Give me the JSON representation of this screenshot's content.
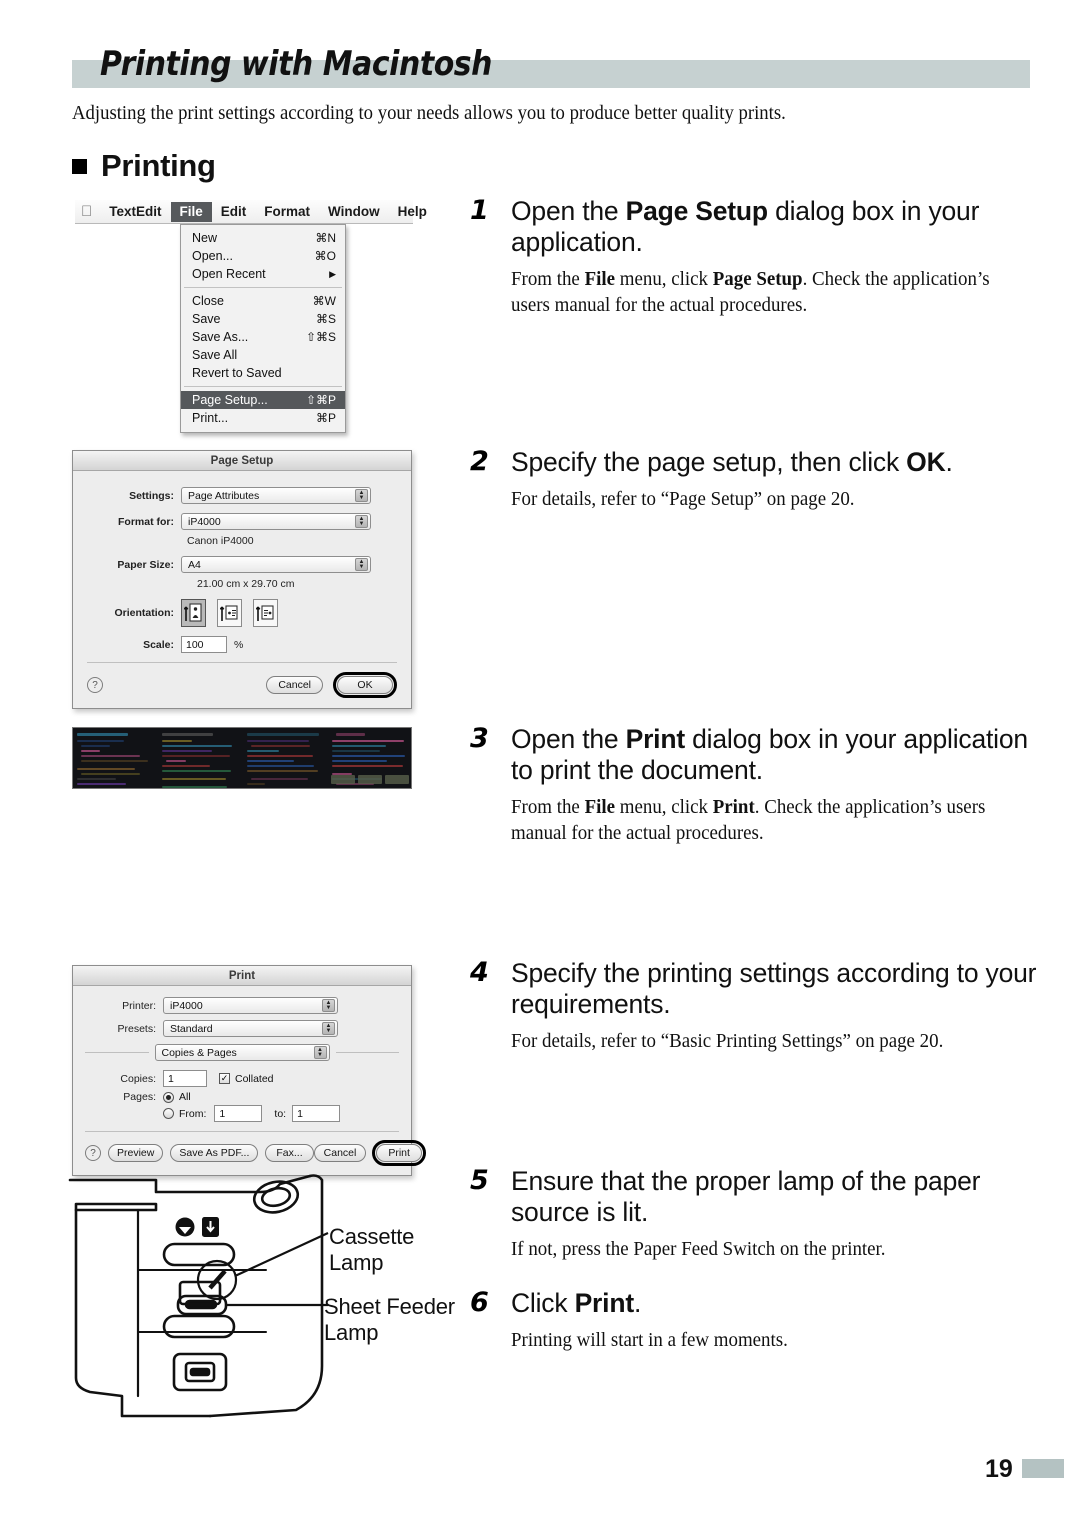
{
  "page": {
    "title": "Printing with Macintosh",
    "intro": "Adjusting the print settings according to your needs allows you to produce better quality prints.",
    "section_heading": "Printing",
    "page_number": "19",
    "header_bar_color": "#c6d1d1",
    "footer_block_color": "#b4c2c2"
  },
  "steps": [
    {
      "num": "1",
      "title_parts": [
        {
          "text": "Open the ",
          "bold": false
        },
        {
          "text": "Page Setup",
          "bold": true
        },
        {
          "text": " dialog box in your application.",
          "bold": false
        }
      ],
      "body_parts": [
        {
          "text": "From the ",
          "bold": false
        },
        {
          "text": "File",
          "bold": true
        },
        {
          "text": " menu, click ",
          "bold": false
        },
        {
          "text": "Page Setup",
          "bold": true
        },
        {
          "text": ". Check the application’s users manual for the actual procedures.",
          "bold": false
        }
      ]
    },
    {
      "num": "2",
      "title_parts": [
        {
          "text": "Specify the page setup, then click ",
          "bold": false
        },
        {
          "text": "OK",
          "bold": true
        },
        {
          "text": ".",
          "bold": false
        }
      ],
      "body_parts": [
        {
          "text": "For details, refer to “Page Setup” on page 20.",
          "bold": false
        }
      ]
    },
    {
      "num": "3",
      "title_parts": [
        {
          "text": "Open the ",
          "bold": false
        },
        {
          "text": "Print",
          "bold": true
        },
        {
          "text": " dialog box in your application to print the document.",
          "bold": false
        }
      ],
      "body_parts": [
        {
          "text": "From the ",
          "bold": false
        },
        {
          "text": "File",
          "bold": true
        },
        {
          "text": " menu, click ",
          "bold": false
        },
        {
          "text": "Print",
          "bold": true
        },
        {
          "text": ". Check the application’s users manual for the actual procedures.",
          "bold": false
        }
      ]
    },
    {
      "num": "4",
      "title_parts": [
        {
          "text": "Specify the printing settings according to your requirements.",
          "bold": false
        }
      ],
      "body_parts": [
        {
          "text": "For details, refer to “Basic Printing Settings” on page 20.",
          "bold": false
        }
      ]
    },
    {
      "num": "5",
      "title_parts": [
        {
          "text": "Ensure that the proper lamp of the paper source is lit.",
          "bold": false
        }
      ],
      "body_parts": [
        {
          "text": "If not, press the Paper Feed Switch on the printer.",
          "bold": false
        }
      ]
    },
    {
      "num": "6",
      "title_parts": [
        {
          "text": "Click ",
          "bold": false
        },
        {
          "text": "Print",
          "bold": true
        },
        {
          "text": ".",
          "bold": false
        }
      ],
      "body_parts": [
        {
          "text": "Printing will start in a few moments.",
          "bold": false
        }
      ]
    }
  ],
  "menu_screenshot": {
    "menubar": {
      "apple_icon": "apple-icon",
      "items": [
        {
          "label": "TextEdit",
          "selected": false
        },
        {
          "label": "File",
          "selected": true
        },
        {
          "label": "Edit",
          "selected": false
        },
        {
          "label": "Format",
          "selected": false
        },
        {
          "label": "Window",
          "selected": false
        },
        {
          "label": "Help",
          "selected": false
        }
      ]
    },
    "file_menu": [
      {
        "label": "New",
        "key": "⌘N",
        "highlight": false,
        "separator_after": false
      },
      {
        "label": "Open...",
        "key": "⌘O",
        "highlight": false,
        "separator_after": false
      },
      {
        "label": "Open Recent",
        "key": "▶",
        "highlight": false,
        "separator_after": true
      },
      {
        "label": "Close",
        "key": "⌘W",
        "highlight": false,
        "separator_after": false
      },
      {
        "label": "Save",
        "key": "⌘S",
        "highlight": false,
        "separator_after": false
      },
      {
        "label": "Save As...",
        "key": "⇧⌘S",
        "highlight": false,
        "separator_after": false
      },
      {
        "label": "Save All",
        "key": "",
        "highlight": false,
        "separator_after": false
      },
      {
        "label": "Revert to Saved",
        "key": "",
        "highlight": false,
        "separator_after": true
      },
      {
        "label": "Page Setup...",
        "key": "⇧⌘P",
        "highlight": true,
        "separator_after": false
      },
      {
        "label": "Print...",
        "key": "⌘P",
        "highlight": false,
        "separator_after": false
      }
    ]
  },
  "page_setup_dialog": {
    "title": "Page Setup",
    "settings_label": "Settings:",
    "settings_value": "Page Attributes",
    "format_for_label": "Format for:",
    "format_for_value": "iP4000",
    "printer_note": "Canon iP4000",
    "paper_size_label": "Paper Size:",
    "paper_size_value": "A4",
    "paper_dimensions": "21.00 cm x 29.70 cm",
    "orientation_label": "Orientation:",
    "orientation_options": [
      "portrait",
      "landscape",
      "landscape-reverse"
    ],
    "orientation_selected_index": 0,
    "scale_label": "Scale:",
    "scale_value": "100",
    "scale_unit": "%",
    "help_label": "?",
    "cancel_label": "Cancel",
    "ok_label": "OK"
  },
  "print_dialog": {
    "title": "Print",
    "printer_label": "Printer:",
    "printer_value": "iP4000",
    "presets_label": "Presets:",
    "presets_value": "Standard",
    "pane_value": "Copies & Pages",
    "copies_label": "Copies:",
    "copies_value": "1",
    "collated_label": "Collated",
    "collated_checked": true,
    "pages_label": "Pages:",
    "pages_all_label": "All",
    "pages_all_selected": true,
    "pages_from_label": "From:",
    "pages_from_value": "1",
    "pages_to_label": "to:",
    "pages_to_value": "1",
    "help_label": "?",
    "preview_label": "Preview",
    "save_as_pdf_label": "Save As PDF...",
    "fax_label": "Fax...",
    "cancel_label": "Cancel",
    "print_label": "Print"
  },
  "printer_illustration": {
    "cassette_lamp_label": "Cassette\nLamp",
    "cassette_lamp_line1": "Cassette",
    "cassette_lamp_line2": "Lamp",
    "sheet_feeder_lamp_line1": "Sheet Feeder",
    "sheet_feeder_lamp_line2": "Lamp"
  }
}
